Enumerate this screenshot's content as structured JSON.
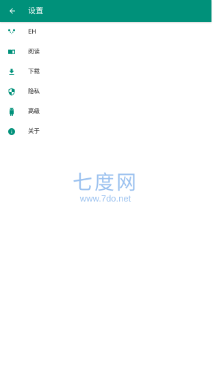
{
  "toolbar": {
    "title": "设置",
    "color": "#00917a"
  },
  "menu": {
    "items": [
      {
        "label": "EH",
        "icon": "panda-icon"
      },
      {
        "label": "阅读",
        "icon": "book-icon"
      },
      {
        "label": "下载",
        "icon": "download-icon"
      },
      {
        "label": "隐私",
        "icon": "shield-icon"
      },
      {
        "label": "高级",
        "icon": "android-icon"
      },
      {
        "label": "关于",
        "icon": "info-icon"
      }
    ],
    "icon_color": "#00917a"
  },
  "watermark": {
    "logo": "七度网",
    "url": "www.7do.net",
    "color": "#4a90e2"
  }
}
